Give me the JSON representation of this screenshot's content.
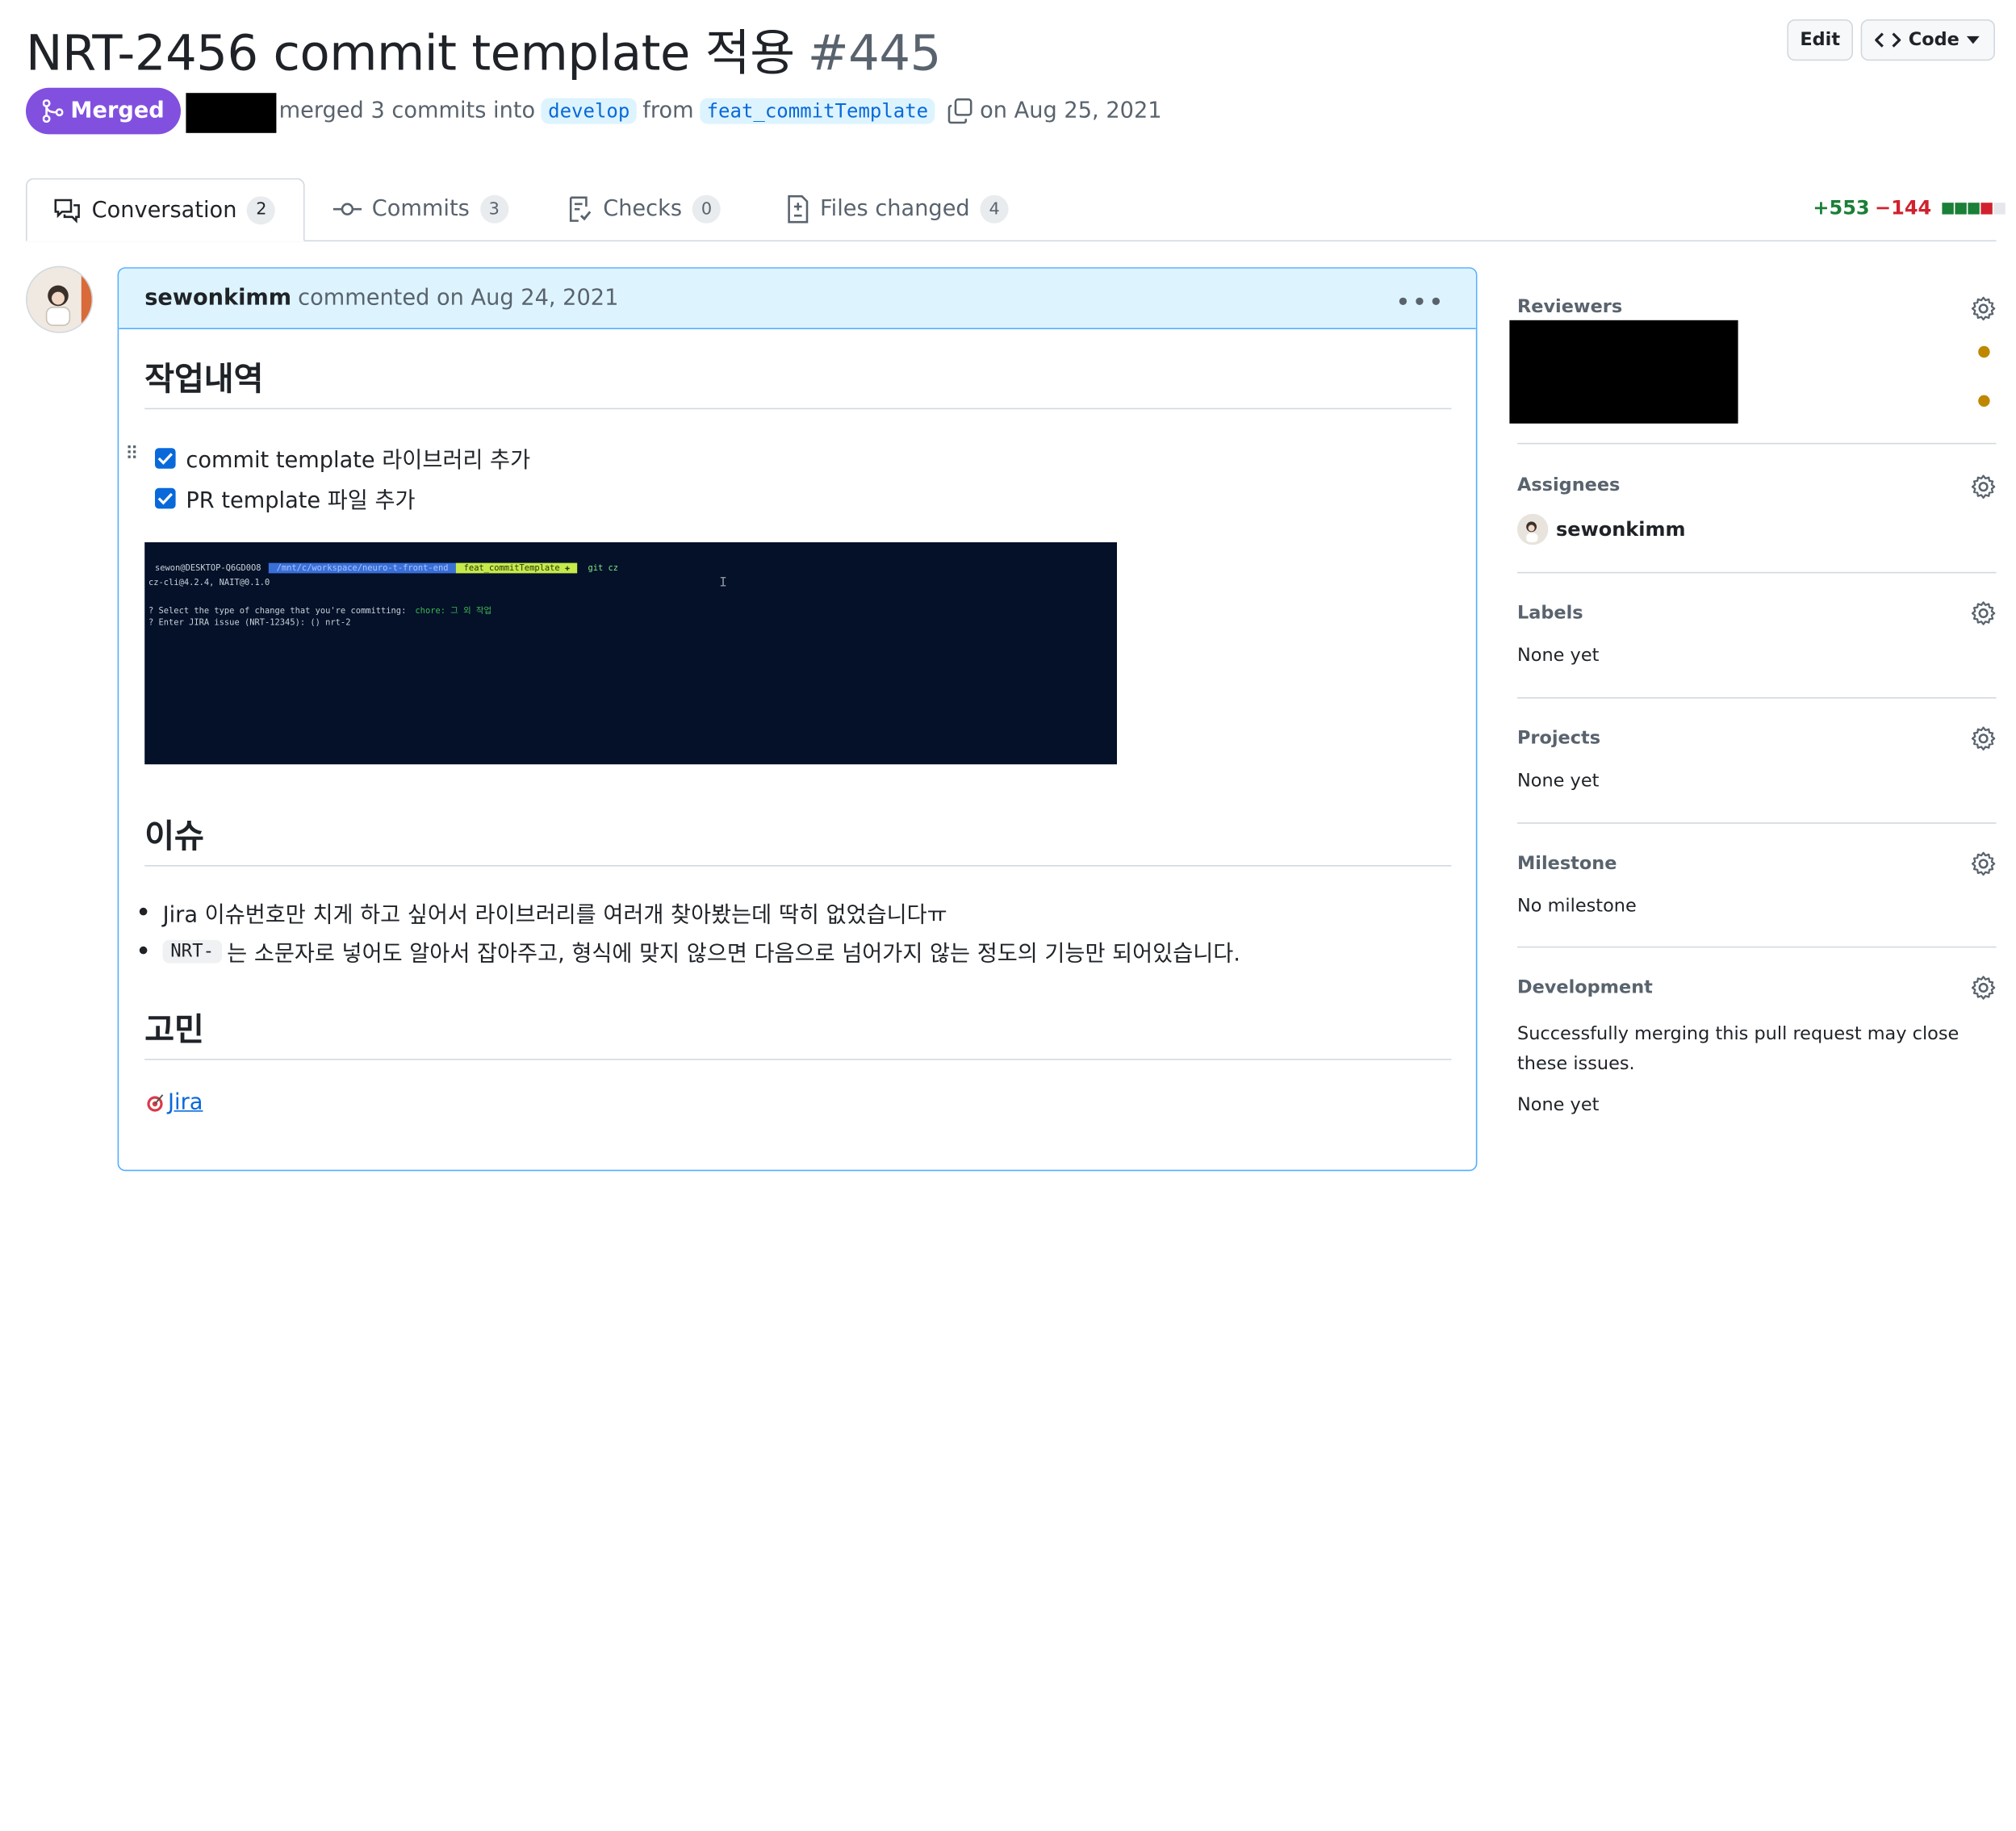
{
  "header": {
    "title": "NRT-2456 commit template 적용",
    "number": "#445",
    "edit_label": "Edit",
    "code_label": "Code"
  },
  "merge_info": {
    "status": "Merged",
    "text_merged": "merged 3 commits into",
    "base_branch": "develop",
    "text_from": "from",
    "head_branch": "feat_commitTemplate",
    "date_text": "on Aug 25, 2021"
  },
  "tabs": [
    {
      "label": "Conversation",
      "count": "2",
      "icon": "comment-discussion-icon"
    },
    {
      "label": "Commits",
      "count": "3",
      "icon": "git-commit-icon"
    },
    {
      "label": "Checks",
      "count": "0",
      "icon": "checklist-icon"
    },
    {
      "label": "Files changed",
      "count": "4",
      "icon": "file-diff-icon"
    }
  ],
  "diffstat": {
    "additions": "+553",
    "deletions": "−144",
    "green": "#1a7f37",
    "red": "#cf222e"
  },
  "comment": {
    "author": "sewonkimm",
    "meta": "commented on Aug 24, 2021",
    "section1_title": "작업내역",
    "tasks": [
      {
        "label": "commit template 라이브러리 추가",
        "checked": true
      },
      {
        "label": "PR template 파일 추가",
        "checked": true
      }
    ],
    "terminal": {
      "prompt_user": "sewon@DESKTOP-Q6GD0O8",
      "prompt_path": "/mnt/c/workspace/neuro-t-front-end",
      "prompt_branch": "feat_commitTemplate ✚",
      "command": "git cz",
      "line2": "cz-cli@4.2.4, NAIT@0.1.0",
      "line3_q": "? Select the type of change that you're committing:",
      "line3_a": "chore:  그 외 작업",
      "line4": "? Enter JIRA issue (NRT-12345): () nrt-2"
    },
    "section2_title": "이슈",
    "bullet1": "Jira 이슈번호만 치게 하고 싶어서 라이브러리를 여러개 찾아봤는데 딱히 없었습니다ㅠ",
    "bullet2_code": "NRT-",
    "bullet2_text": "는 소문자로 넣어도 알아서 잡아주고, 형식에 맞지 않으면 다음으로 넘어가지 않는 정도의 기능만 되어있습니다.",
    "section3_title": "고민",
    "link_label": "Jira"
  },
  "sidebar": {
    "reviewers_title": "Reviewers",
    "assignees_title": "Assignees",
    "assignee_name": "sewonkimm",
    "labels_title": "Labels",
    "labels_value": "None yet",
    "projects_title": "Projects",
    "projects_value": "None yet",
    "milestone_title": "Milestone",
    "milestone_value": "No milestone",
    "development_title": "Development",
    "development_text": "Successfully merging this pull request may close these issues.",
    "development_value": "None yet"
  },
  "colors": {
    "merged": "#8250df",
    "link": "#0969da",
    "header_bg": "#ddf4ff",
    "pending": "#bf8700"
  }
}
